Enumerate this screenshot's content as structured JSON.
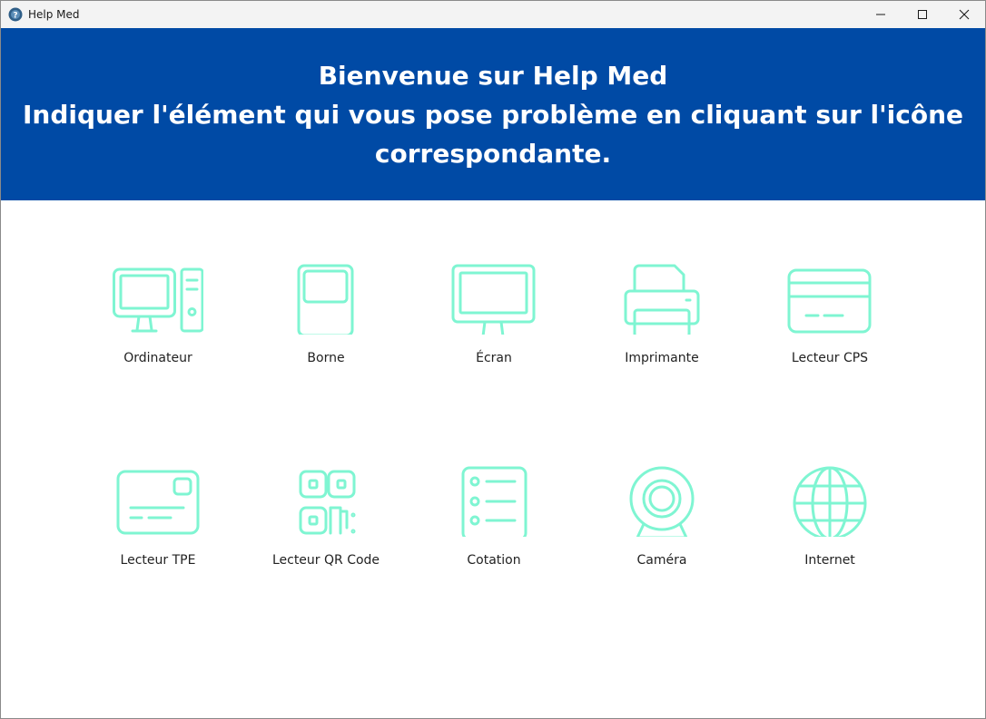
{
  "window": {
    "title": "Help Med"
  },
  "banner": {
    "line1": "Bienvenue sur Help Med",
    "line2": "Indiquer l'élément qui vous pose problème en cliquant sur l'icône",
    "line3": "correspondante."
  },
  "colors": {
    "banner": "#004aa5",
    "icon_stroke": "#7ff5d2",
    "text": "#222222"
  },
  "items": [
    {
      "label": "Ordinateur",
      "icon": "computer-icon"
    },
    {
      "label": "Borne",
      "icon": "kiosk-icon"
    },
    {
      "label": "Écran",
      "icon": "monitor-icon"
    },
    {
      "label": "Imprimante",
      "icon": "printer-icon"
    },
    {
      "label": "Lecteur CPS",
      "icon": "card-reader-icon"
    },
    {
      "label": "Lecteur TPE",
      "icon": "payment-terminal-icon"
    },
    {
      "label": "Lecteur QR Code",
      "icon": "qr-code-icon"
    },
    {
      "label": "Cotation",
      "icon": "list-icon"
    },
    {
      "label": "Caméra",
      "icon": "webcam-icon"
    },
    {
      "label": "Internet",
      "icon": "globe-icon"
    }
  ]
}
